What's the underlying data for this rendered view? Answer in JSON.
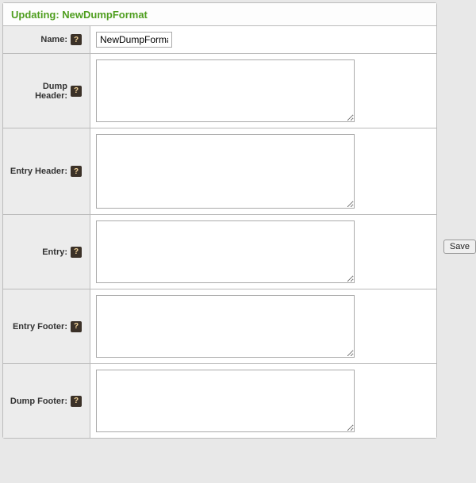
{
  "panel": {
    "title_prefix": "Updating: ",
    "title_name": "NewDumpFormat"
  },
  "fields": {
    "name": {
      "label": "Name:",
      "value": "NewDumpFormat"
    },
    "dump_header": {
      "label": "Dump Header:",
      "value": ""
    },
    "entry_header": {
      "label": "Entry Header:",
      "value": ""
    },
    "entry": {
      "label": "Entry:",
      "value": ""
    },
    "entry_footer": {
      "label": "Entry Footer:",
      "value": ""
    },
    "dump_footer": {
      "label": "Dump Footer:",
      "value": ""
    }
  },
  "help_glyph": "?",
  "buttons": {
    "save": "Save"
  }
}
